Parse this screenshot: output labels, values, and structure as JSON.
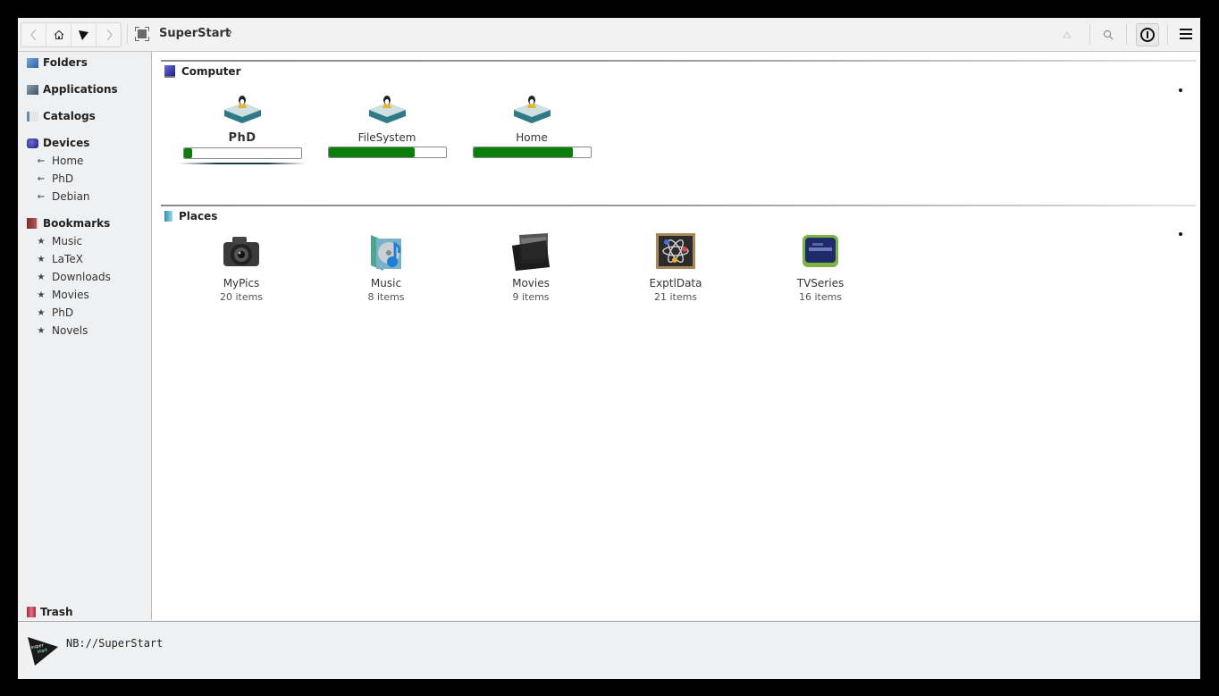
{
  "toolbar": {
    "nav": {
      "back_icon": "chevron-left-icon",
      "home_icon": "home-icon",
      "superstart_icon": "triangle-icon",
      "forward_icon": "chevron-right-icon"
    },
    "breadcrumb": {
      "icon": "superstart-icon",
      "label": "SuperStart",
      "chevron": "›"
    },
    "right": {
      "bookmark_icon": "bookmark-icon",
      "search_icon": "search-icon",
      "addon_icon": "addon-icon",
      "menu_icon": "hamburger-icon"
    }
  },
  "sidebar": {
    "sections": [
      {
        "label": "Folders",
        "icon": "folder-icon"
      },
      {
        "label": "Applications",
        "icon": "applications-icon"
      },
      {
        "label": "Catalogs",
        "icon": "catalog-icon"
      },
      {
        "label": "Devices",
        "icon": "devices-icon",
        "items": [
          "Home",
          "PhD",
          "Debian"
        ]
      },
      {
        "label": "Bookmarks",
        "icon": "bookmarks-icon",
        "items": [
          "Music",
          "LaTeX",
          "Downloads",
          "Movies",
          "PhD",
          "Novels"
        ]
      }
    ],
    "trash": {
      "label": "Trash",
      "icon": "trash-icon"
    }
  },
  "main": {
    "computer": {
      "title": "Computer",
      "drives": [
        {
          "name": "PhD",
          "usage_percent": 7,
          "selected": true
        },
        {
          "name": "FileSystem",
          "usage_percent": 74
        },
        {
          "name": "Home",
          "usage_percent": 85
        }
      ]
    },
    "places": {
      "title": "Places",
      "items": [
        {
          "name": "MyPics",
          "count": "20 items",
          "icon": "camera-icon"
        },
        {
          "name": "Music",
          "count": "8 items",
          "icon": "music-icon"
        },
        {
          "name": "Movies",
          "count": "9 items",
          "icon": "film-icon"
        },
        {
          "name": "ExptlData",
          "count": "21 items",
          "icon": "atom-icon"
        },
        {
          "name": "TVSeries",
          "count": "16 items",
          "icon": "tv-icon"
        }
      ]
    }
  },
  "statusbar": {
    "text": "NB://SuperStart",
    "logo_text": "super start"
  },
  "colors": {
    "usage_bar": "#0b7d0b",
    "selection_underline": "#1c3c52"
  }
}
